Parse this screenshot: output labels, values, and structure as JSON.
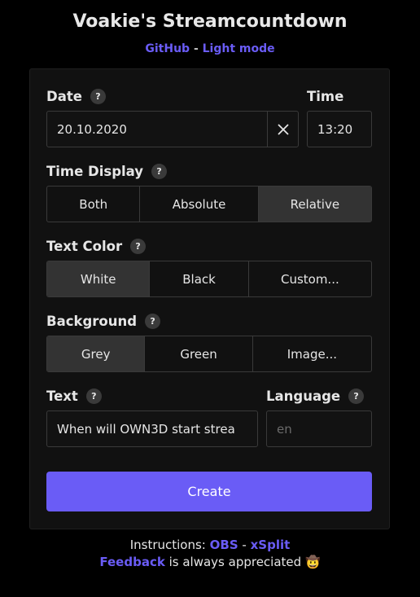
{
  "header": {
    "title": "Voakie's Streamcountdown",
    "github_link": "GitHub",
    "separator": "-",
    "light_mode_link": "Light mode"
  },
  "form": {
    "date": {
      "label": "Date",
      "help": "?",
      "value": "20.10.2020"
    },
    "time": {
      "label": "Time",
      "value": "13:20"
    },
    "time_display": {
      "label": "Time Display",
      "help": "?",
      "options": [
        "Both",
        "Absolute",
        "Relative"
      ],
      "selected": "Relative"
    },
    "text_color": {
      "label": "Text Color",
      "help": "?",
      "options": [
        "White",
        "Black",
        "Custom..."
      ],
      "selected": "White"
    },
    "background": {
      "label": "Background",
      "help": "?",
      "options": [
        "Grey",
        "Green",
        "Image..."
      ],
      "selected": "Grey"
    },
    "text": {
      "label": "Text",
      "help": "?",
      "value": "When will OWN3D start strea"
    },
    "language": {
      "label": "Language",
      "help": "?",
      "placeholder": "en"
    },
    "create_label": "Create"
  },
  "footer": {
    "instructions_prefix": "Instructions:",
    "obs_link": "OBS",
    "separator": "-",
    "xsplit_link": "xSplit",
    "feedback_link": "Feedback",
    "feedback_suffix": "is always appreciated",
    "emoji": "🤠"
  }
}
